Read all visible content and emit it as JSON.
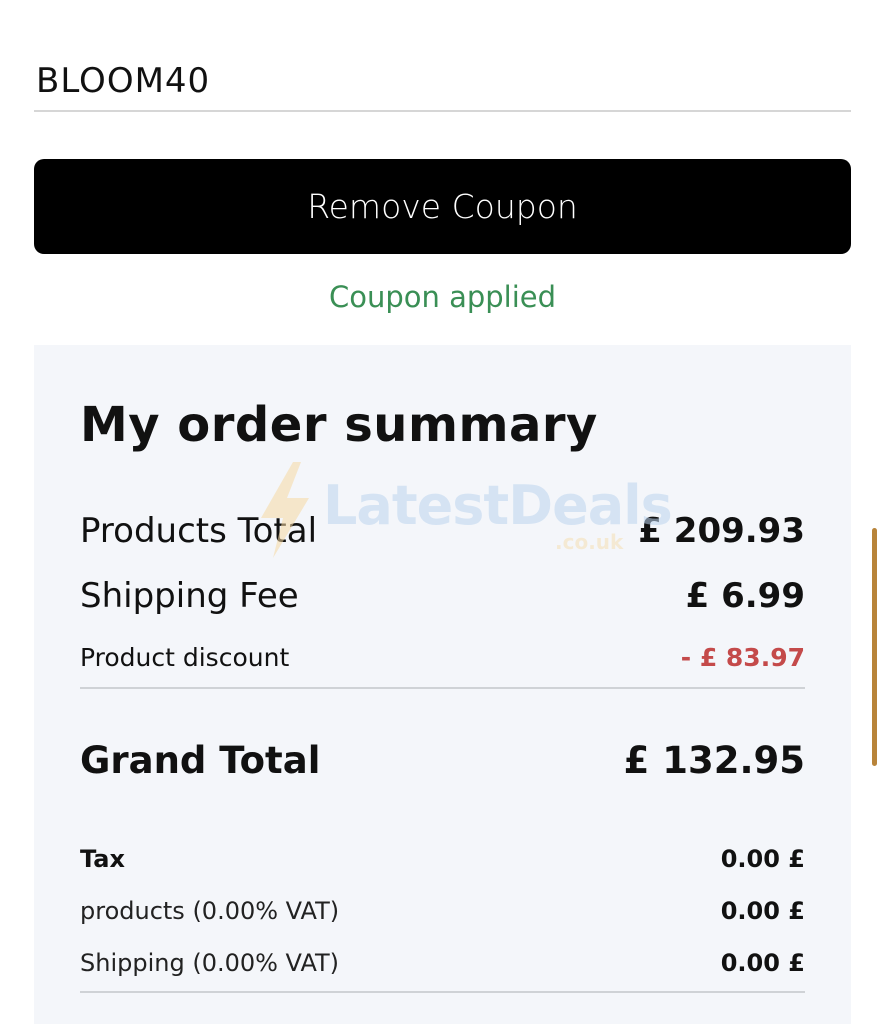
{
  "coupon": {
    "code": "BLOOM40",
    "remove_label": "Remove Coupon",
    "status": "Coupon applied"
  },
  "summary": {
    "title": "My order summary",
    "products_total_label": "Products Total",
    "products_total_value": "£ 209.93",
    "shipping_fee_label": "Shipping Fee",
    "shipping_fee_value": "£ 6.99",
    "discount_label": "Product discount",
    "discount_value": "- £ 83.97",
    "grand_total_label": "Grand Total",
    "grand_total_value": "£ 132.95",
    "tax_label": "Tax",
    "tax_value": "0.00 £",
    "products_vat_label": "products (0.00% VAT)",
    "products_vat_value": "0.00 £",
    "shipping_vat_label": "Shipping (0.00% VAT)",
    "shipping_vat_value": "0.00 £"
  },
  "watermark": {
    "brand": "LatestDeals",
    "domain": ".co.uk",
    "icon": "lightning-bolt-icon"
  },
  "colors": {
    "button_bg": "#000000",
    "status_green": "#3a8f55",
    "discount_red": "#c44a4a",
    "panel_bg": "#f4f6fa",
    "scrollbar": "#b8843a"
  }
}
